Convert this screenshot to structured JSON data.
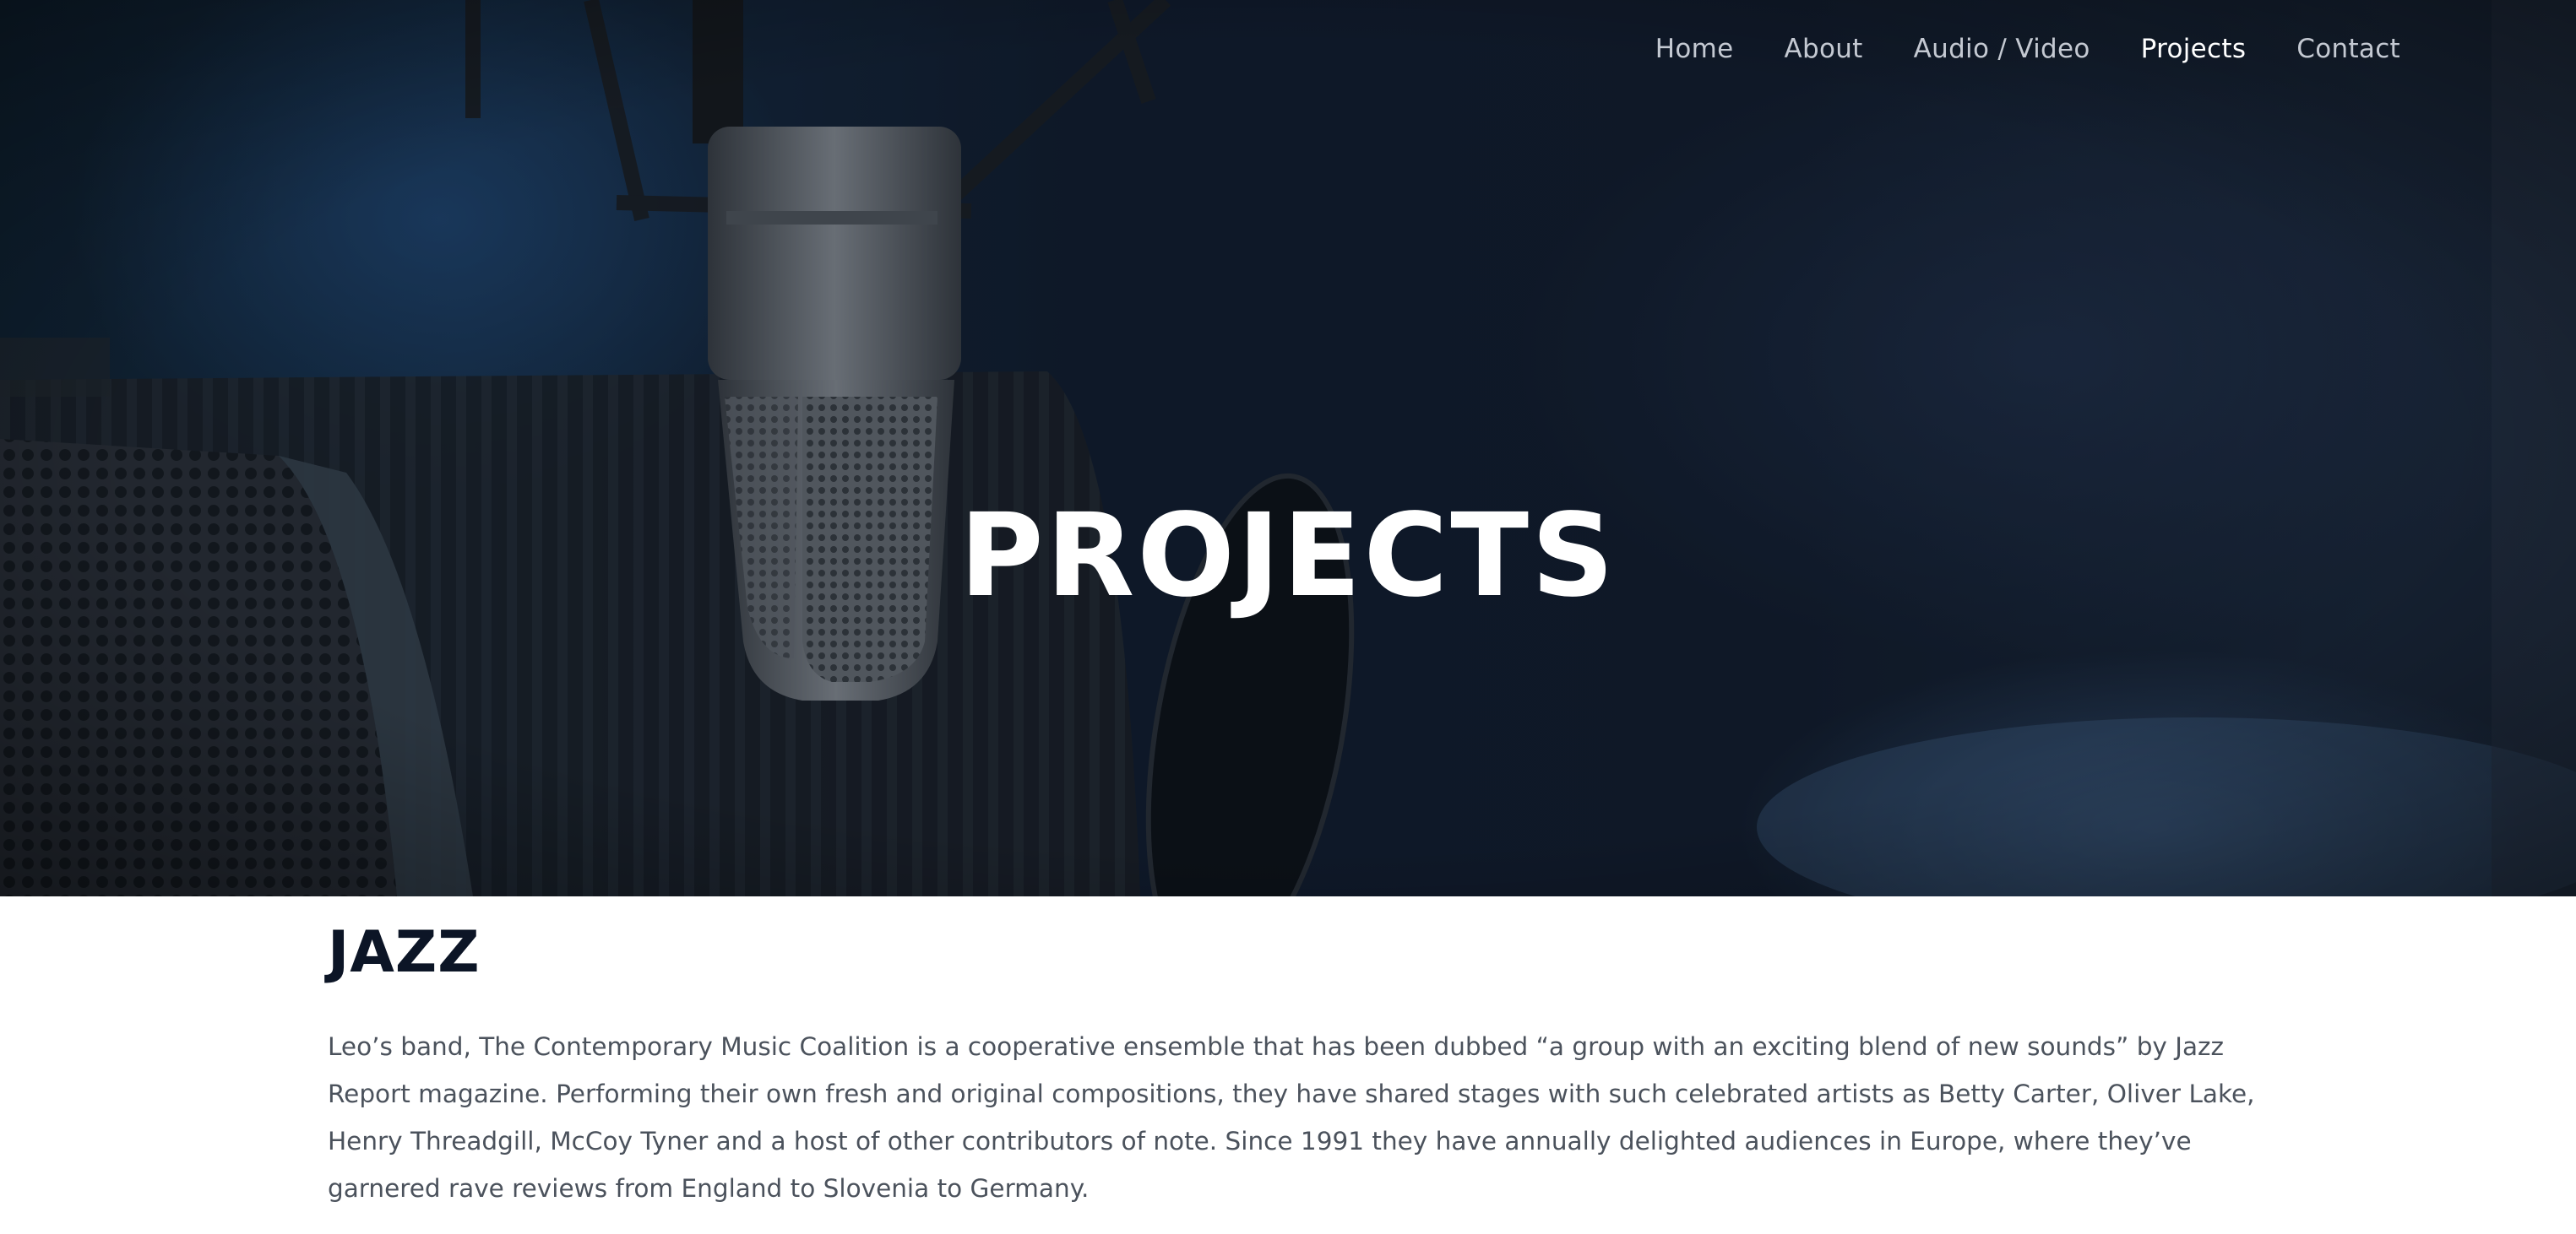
{
  "nav": {
    "items": [
      {
        "label": "Home",
        "active": false
      },
      {
        "label": "About",
        "active": false
      },
      {
        "label": "Audio / Video",
        "active": false
      },
      {
        "label": "Projects",
        "active": true
      },
      {
        "label": "Contact",
        "active": false
      }
    ]
  },
  "hero": {
    "title": "PROJECTS"
  },
  "section": {
    "heading": "JAZZ",
    "body": "Leo’s band, The Contemporary Music Coalition is a cooperative ensemble that has been dubbed “a group with an exciting blend of new sounds” by Jazz Report magazine. Performing their own fresh and original compositions, they have shared stages with such celebrated artists as Betty Carter, Oliver Lake, Henry Threadgill, McCoy Tyner and a host of other contributors of note. Since 1991 they have annually delighted audiences in Europe, where they’ve garnered rave reviews from England to Slovenia to Germany."
  },
  "colors": {
    "nav_text": "#c4c9d2",
    "nav_active": "#ffffff",
    "heading": "#0c1526",
    "body_text": "#4b525c"
  }
}
